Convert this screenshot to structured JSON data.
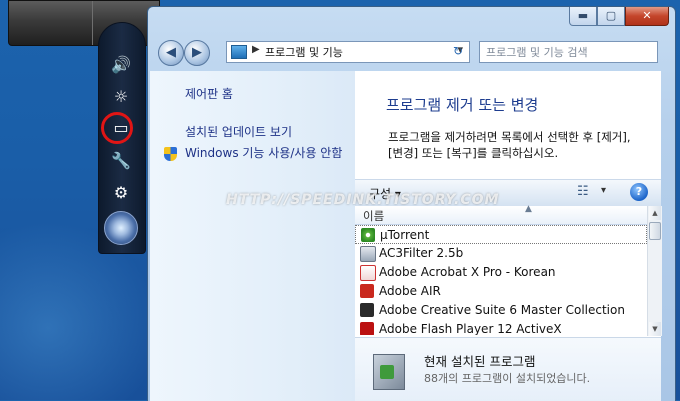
{
  "window": {
    "controls": {
      "minimize": "▬",
      "maximize": "▢",
      "close": "✕"
    }
  },
  "address": {
    "chevron": "▶",
    "path": "프로그램 및 기능",
    "dropdown": "▾",
    "refresh": "↻"
  },
  "search": {
    "placeholder": "프로그램 및 기능 검색"
  },
  "nav": {
    "back": "◀",
    "forward": "▶"
  },
  "sidebar": {
    "links": [
      "제어판 홈",
      "설치된 업데이트 보기",
      "Windows 기능 사용/사용 안함"
    ]
  },
  "main": {
    "heading": "프로그램 제거 또는 변경",
    "description": "프로그램을 제거하려면 목록에서 선택한 후 [제거], [변경] 또는 [복구]를 클릭하십시오."
  },
  "toolbar": {
    "organize": "구성 ▾",
    "view_icon": "☷",
    "view_drop": "▾",
    "help": "?"
  },
  "table": {
    "column": "이름",
    "sort_arrow": "▲",
    "rows": [
      {
        "name": "µTorrent",
        "icon": "utorrent-icon"
      },
      {
        "name": "AC3Filter 2.5b",
        "icon": "ac3filter-icon"
      },
      {
        "name": "Adobe Acrobat X Pro - Korean",
        "icon": "acrobat-icon"
      },
      {
        "name": "Adobe AIR",
        "icon": "adobe-air-icon"
      },
      {
        "name": "Adobe Creative Suite 6 Master Collection",
        "icon": "adobe-cs6-icon"
      },
      {
        "name": "Adobe Flash Player 12 ActiveX",
        "icon": "flash-player-icon"
      }
    ]
  },
  "scrollbar": {
    "up": "▲",
    "down": "▼"
  },
  "details": {
    "title": "현재 설치된 프로그램",
    "subtitle": "88개의 프로그램이 설치되었습니다."
  },
  "dock": {
    "icons": [
      "🔊",
      "☼",
      "▭",
      "🔧",
      "⚙"
    ]
  },
  "watermark": "HTTP://SPEEDINK.TISTORY.COM",
  "colors": {
    "highlight_ring": "#e01515",
    "link": "#1e3287",
    "heading": "#1e3d8f"
  }
}
